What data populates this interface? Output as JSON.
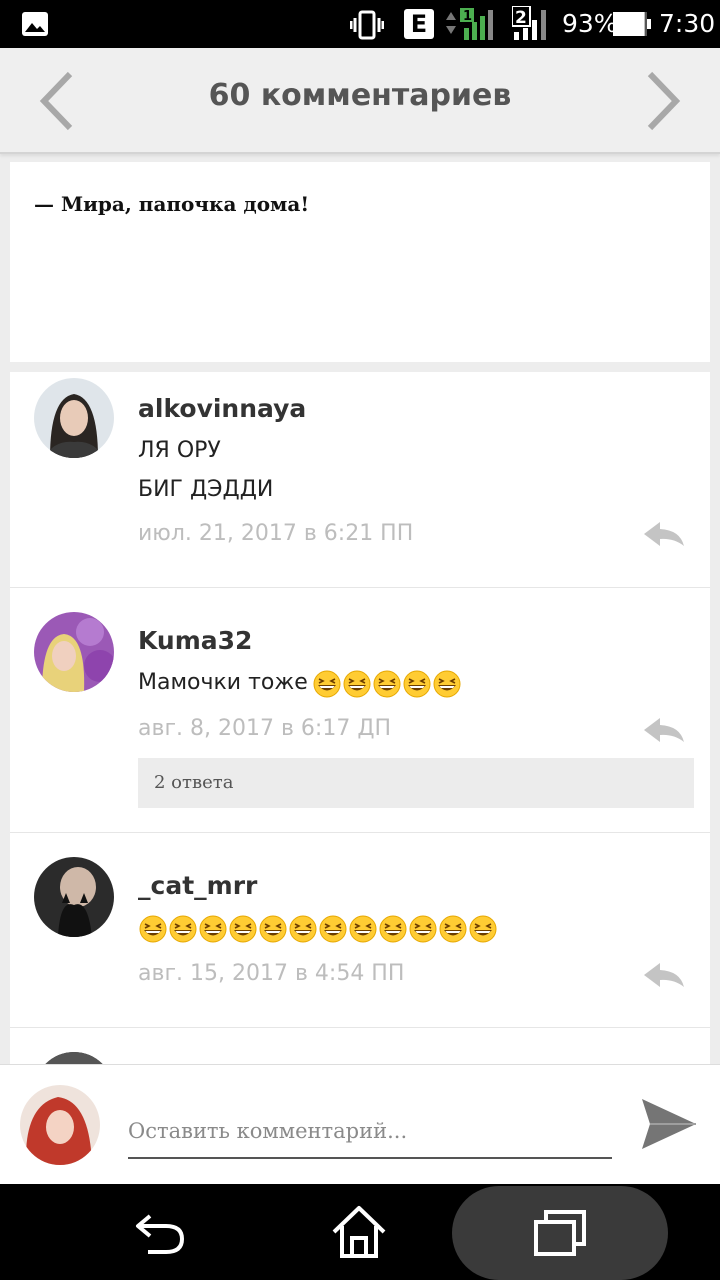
{
  "status_bar": {
    "network_type": "E",
    "sim1_label": "1",
    "sim2_label": "2",
    "battery_percent": "93%",
    "battery_level": 0.93,
    "time": "7:30",
    "icons": [
      "gallery-icon",
      "vibrate-icon",
      "signal-icon",
      "battery-icon"
    ]
  },
  "header": {
    "title": "60 комментариев",
    "prev_icon": "chevron-left-icon",
    "next_icon": "chevron-right-icon"
  },
  "post": {
    "text": "— Мира, папочка дома!"
  },
  "comments": [
    {
      "username": "alkovinnaya",
      "lines": [
        "ЛЯ ОРУ",
        "БИГ ДЭДДИ"
      ],
      "date": "июл. 21, 2017 в 6:21 ПП"
    },
    {
      "username": "Kuma32",
      "text": "Мамочки тоже",
      "emoji": "grinning-squinting-face",
      "emoji_count": 5,
      "date": "авг. 8, 2017 в 6:17 ДП",
      "replies_label": "2 ответа"
    },
    {
      "username": "_cat_mrr",
      "emoji": "grinning-squinting-face",
      "emoji_count": 12,
      "date": "авг. 15, 2017 в 4:54 ПП"
    }
  ],
  "input": {
    "placeholder": "Оставить комментарий...",
    "send_icon": "send-icon"
  },
  "colors": {
    "header_bg": "#efefef",
    "page_bg": "#ededed",
    "date_gray": "#bdbdbd",
    "replies_bg": "#ececec"
  },
  "nav_bar": {
    "icons": [
      "back-icon",
      "home-icon",
      "recent-apps-icon"
    ]
  }
}
